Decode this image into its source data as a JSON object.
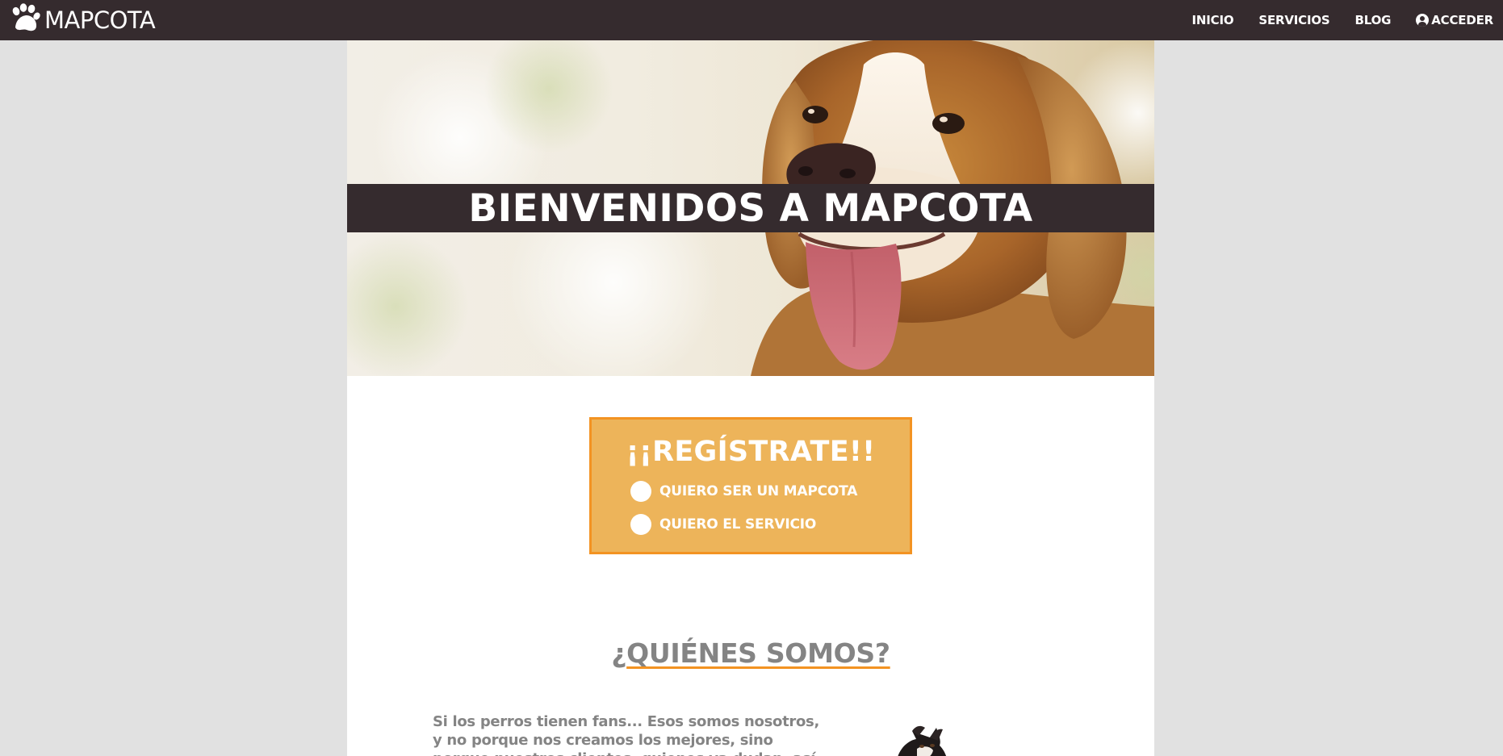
{
  "navbar": {
    "brand": "MAPCOTA",
    "links": [
      {
        "label": "INICIO"
      },
      {
        "label": "SERVICIOS"
      },
      {
        "label": "BLOG"
      },
      {
        "label": "ACCEDER",
        "icon": "user-circle-icon"
      }
    ]
  },
  "hero": {
    "title": "BIENVENIDOS A MAPCOTA"
  },
  "register": {
    "title": "¡¡REGÍSTRATE!!",
    "options": [
      {
        "label": "QUIERO SER UN MAPCOTA"
      },
      {
        "label": "QUIERO EL SERVICIO"
      }
    ]
  },
  "about": {
    "title_prefix": "¿",
    "title_main": "QUIÉNES SOMOS?",
    "text": "Si los perros tienen fans... Esos somos nosotros, y no porque nos creamos los mejores, sino porque nuestros clientes, quienes ya dudan, así nos lo hay"
  },
  "colors": {
    "navbar": "#352b2e",
    "page_background": "#e1e1e1",
    "accent_orange": "#f39322",
    "register_fill": "#edb45a",
    "text_gray": "#848484"
  }
}
